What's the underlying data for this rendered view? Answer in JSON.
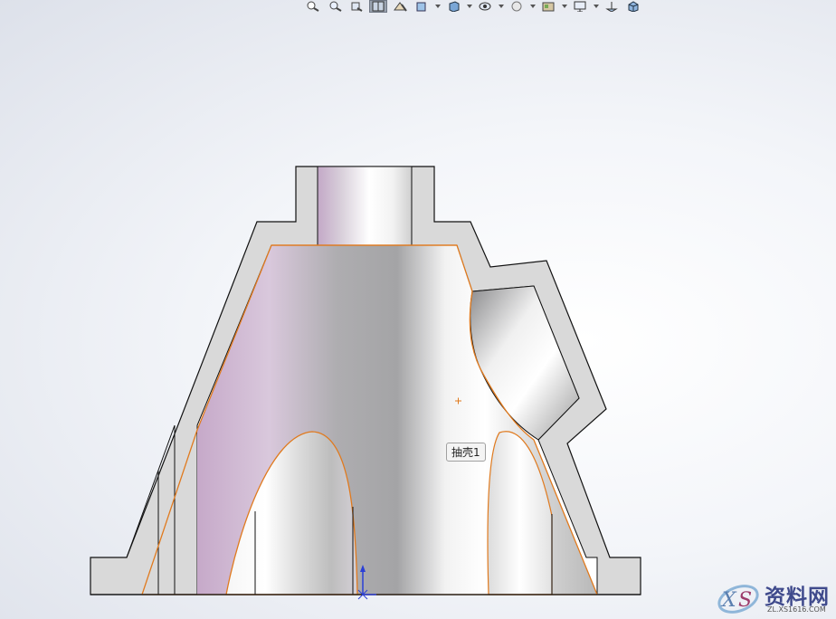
{
  "toolbar": {
    "buttons": [
      {
        "icon": "zoom-to-fit-icon",
        "dropdown": false,
        "active": false
      },
      {
        "icon": "zoom-to-area-icon",
        "dropdown": false,
        "active": false
      },
      {
        "icon": "previous-view-icon",
        "dropdown": false,
        "active": false
      },
      {
        "icon": "section-view-icon",
        "dropdown": false,
        "active": true
      },
      {
        "icon": "dynamic-annotation-icon",
        "dropdown": false,
        "active": false
      },
      {
        "icon": "view-orientation-icon",
        "dropdown": true,
        "active": false
      },
      {
        "icon": "display-style-icon",
        "dropdown": true,
        "active": false
      },
      {
        "icon": "hide-show-items-icon",
        "dropdown": true,
        "active": false
      },
      {
        "icon": "edit-appearance-icon",
        "dropdown": true,
        "active": false
      },
      {
        "icon": "apply-scene-icon",
        "dropdown": true,
        "active": false
      },
      {
        "icon": "view-settings-icon",
        "dropdown": true,
        "active": false
      },
      {
        "icon": "display-pane-icon",
        "dropdown": false,
        "active": false
      },
      {
        "icon": "3d-view-cube-icon",
        "dropdown": false,
        "active": false
      }
    ]
  },
  "model": {
    "feature_tooltip": "抽壳1"
  },
  "watermark": {
    "brand_text": "资料网",
    "url_text": "ZL.XS1616.COM"
  },
  "colors": {
    "edge_highlight": "#e07a1e",
    "shell_wall": "#d9d9d9",
    "accent_purple": "#c4a6c8"
  }
}
